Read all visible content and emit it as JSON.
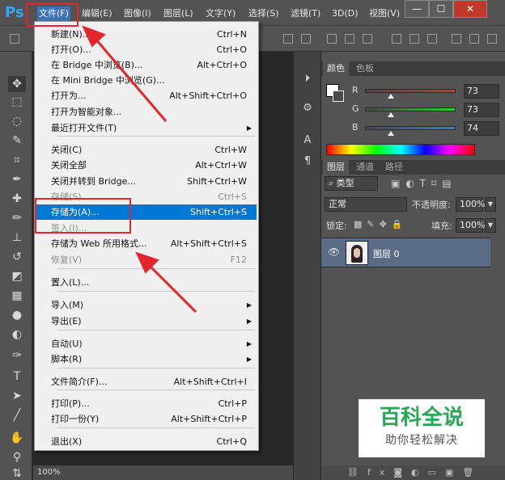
{
  "app": {
    "logo": "Ps"
  },
  "menubar": {
    "items": [
      "文件(F)",
      "编辑(E)",
      "图像(I)",
      "图层(L)",
      "文字(Y)",
      "选择(S)",
      "滤镜(T)",
      "3D(D)",
      "视图(V)",
      "窗"
    ],
    "window_buttons": [
      "—",
      "☐",
      "✕"
    ]
  },
  "file_menu": {
    "items": [
      {
        "label": "新建(N)...",
        "shortcut": "Ctrl+N",
        "state": "normal"
      },
      {
        "label": "打开(O)...",
        "shortcut": "Ctrl+O",
        "state": "normal"
      },
      {
        "label": "在 Bridge 中浏览(B)...",
        "shortcut": "Alt+Ctrl+O",
        "state": "normal"
      },
      {
        "label": "在 Mini Bridge 中浏览(G)...",
        "shortcut": "",
        "state": "normal"
      },
      {
        "label": "打开为...",
        "shortcut": "Alt+Shift+Ctrl+O",
        "state": "normal"
      },
      {
        "label": "打开为智能对象...",
        "shortcut": "",
        "state": "normal"
      },
      {
        "label": "最近打开文件(T)",
        "shortcut": "",
        "state": "submenu"
      },
      {
        "label": "关闭(C)",
        "shortcut": "Ctrl+W",
        "state": "normal"
      },
      {
        "label": "关闭全部",
        "shortcut": "Alt+Ctrl+W",
        "state": "normal"
      },
      {
        "label": "关闭并转到 Bridge...",
        "shortcut": "Shift+Ctrl+W",
        "state": "normal"
      },
      {
        "label": "存储(S)",
        "shortcut": "Ctrl+S",
        "state": "disabled"
      },
      {
        "label": "存储为(A)...",
        "shortcut": "Shift+Ctrl+S",
        "state": "highlighted"
      },
      {
        "label": "签入(I)...",
        "shortcut": "",
        "state": "disabled"
      },
      {
        "label": "存储为 Web 所用格式...",
        "shortcut": "Alt+Shift+Ctrl+S",
        "state": "normal"
      },
      {
        "label": "恢复(V)",
        "shortcut": "F12",
        "state": "disabled"
      },
      {
        "label": "置入(L)...",
        "shortcut": "",
        "state": "normal"
      },
      {
        "label": "导入(M)",
        "shortcut": "",
        "state": "submenu"
      },
      {
        "label": "导出(E)",
        "shortcut": "",
        "state": "submenu"
      },
      {
        "label": "自动(U)",
        "shortcut": "",
        "state": "submenu"
      },
      {
        "label": "脚本(R)",
        "shortcut": "",
        "state": "submenu"
      },
      {
        "label": "文件简介(F)...",
        "shortcut": "Alt+Shift+Ctrl+I",
        "state": "normal"
      },
      {
        "label": "打印(P)...",
        "shortcut": "Ctrl+P",
        "state": "normal"
      },
      {
        "label": "打印一份(Y)",
        "shortcut": "Alt+Shift+Ctrl+P",
        "state": "normal"
      },
      {
        "label": "退出(X)",
        "shortcut": "Ctrl+Q",
        "state": "normal"
      }
    ]
  },
  "color_panel": {
    "tabs": [
      "颜色",
      "色板"
    ],
    "channels": [
      {
        "label": "R",
        "value": "73",
        "level": 0.29,
        "gradient": "#d23232"
      },
      {
        "label": "G",
        "value": "73",
        "level": 0.29,
        "gradient": "#32c832"
      },
      {
        "label": "B",
        "value": "74",
        "level": 0.29,
        "gradient": "#3c78d8"
      }
    ]
  },
  "layers_panel": {
    "tabs": [
      "图层",
      "通道",
      "路径"
    ],
    "filter": "类型",
    "blend_mode": "正常",
    "opacity_label": "不透明度:",
    "opacity_value": "100%",
    "lock_label": "锁定:",
    "fill_label": "填充:",
    "fill_value": "100%",
    "layers": [
      {
        "name": "图层 0",
        "visible": true
      }
    ]
  },
  "status": {
    "zoom": "100%"
  },
  "watermark": {
    "title": "百科全说",
    "subtitle": "助你轻松解决"
  }
}
